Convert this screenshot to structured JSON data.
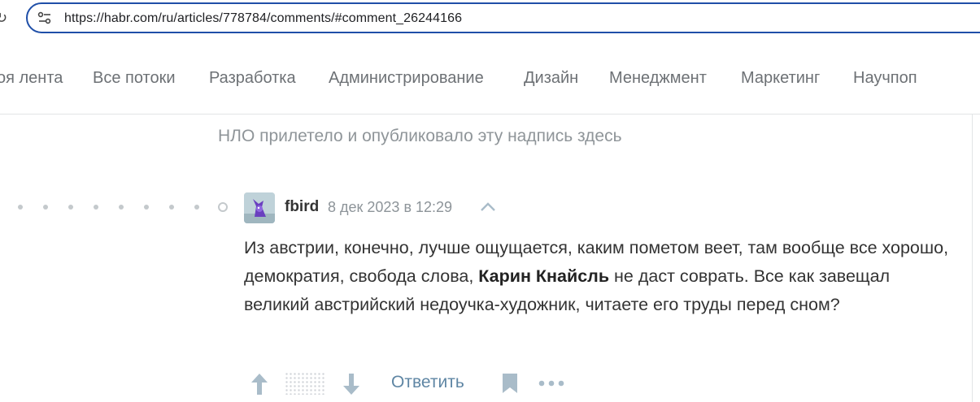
{
  "browser": {
    "url": "https://habr.com/ru/articles/778784/comments/#comment_26244166"
  },
  "nav": {
    "items": [
      "оя лента",
      "Все потоки",
      "Разработка",
      "Администрирование",
      "Дизайн",
      "Менеджмент",
      "Маркетинг",
      "Научпоп"
    ]
  },
  "notice": "НЛО прилетело и опубликовало эту надпись здесь",
  "comment": {
    "author": "fbird",
    "date": "8 дек 2023 в 12:29",
    "text_part1": "Из австрии, конечно, лучше ощущается, каким пометом веет, там вообще все хорошо, демократия, свобода слова, ",
    "text_bold": "Карин Кнайсль",
    "text_part2": " не даст соврать. Все как завещал великий австрийский недоучка-художник, читаете его труды перед сном?",
    "reply_label": "Ответить"
  },
  "icons": {
    "reload": "reload-icon",
    "site_info": "site-settings-icon",
    "chevron": "chevron-up-icon",
    "upvote": "arrow-up-icon",
    "downvote": "arrow-down-icon",
    "bookmark": "bookmark-icon",
    "more": "more-dots-icon"
  },
  "colors": {
    "url_border": "#1f4fa8",
    "reply_link": "#5f86a4",
    "vote_icon": "#a9bcc9"
  }
}
